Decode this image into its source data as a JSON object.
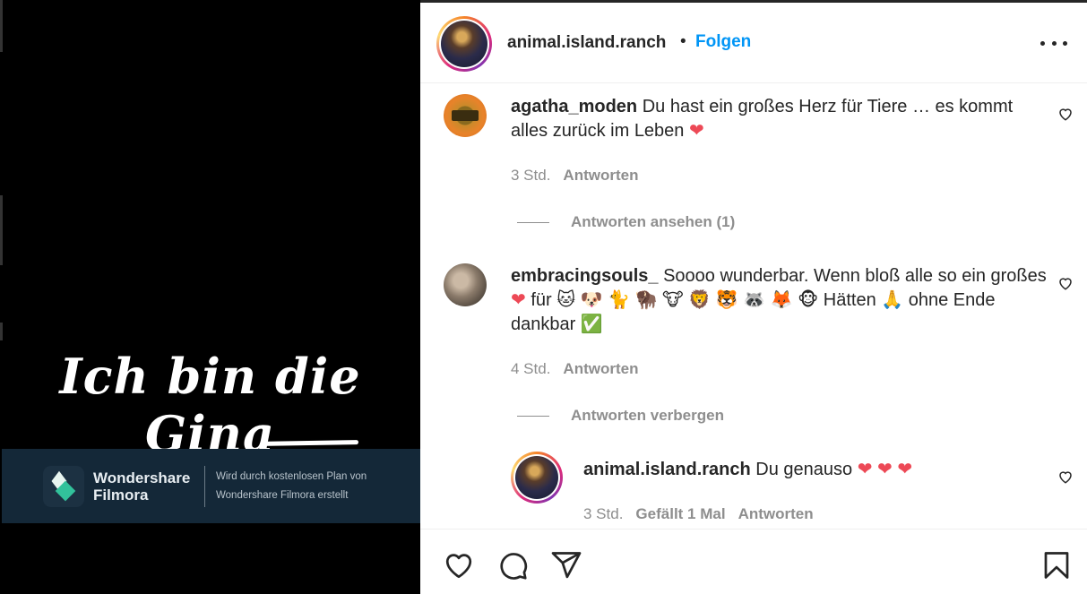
{
  "video": {
    "caption": "Ich bin die Gina",
    "watermark_brand_line1": "Wondershare",
    "watermark_brand_line2": "Filmora",
    "watermark_note_line1": "Wird durch kostenlosen Plan von",
    "watermark_note_line2": "Wondershare Filmora erstellt"
  },
  "header": {
    "username": "animal.island.ranch",
    "separator": "•",
    "follow_label": "Folgen"
  },
  "comments": [
    {
      "username": "agatha_moden",
      "text": "Du hast ein großes Herz für Tiere … es kommt alles zurück im Leben",
      "emoji": "❤",
      "time": "3 Std.",
      "reply_label": "Antworten",
      "thread_label": "Antworten ansehen (1)"
    },
    {
      "username": "embracingsouls_",
      "text_before": "Soooo wunderbar. Wenn bloß alle so ein großes",
      "heart": "❤",
      "text_middle": "für",
      "animals": "🐱 🐶 🐈 🦬 🐮 🦁 🐯 🦝 🦊 🐵",
      "text_after": "Hätten",
      "pray": "🙏",
      "text_end": "ohne Ende dankbar",
      "check": "✅",
      "time": "4 Std.",
      "reply_label": "Antworten",
      "thread_label": "Antworten verbergen"
    }
  ],
  "reply": {
    "username": "animal.island.ranch",
    "text": "Du genauso",
    "hearts": "❤ ❤ ❤",
    "time": "3 Std.",
    "likes_label": "Gefällt 1 Mal",
    "reply_label": "Antworten"
  },
  "colors": {
    "follow": "#0095f6",
    "heart": "#ed4956",
    "meta": "#8e8e8e",
    "watermark_bg": "#142838"
  },
  "icons": [
    "heart-icon",
    "comment-icon",
    "share-icon",
    "bookmark-icon",
    "more-icon",
    "like-comment-icon"
  ]
}
